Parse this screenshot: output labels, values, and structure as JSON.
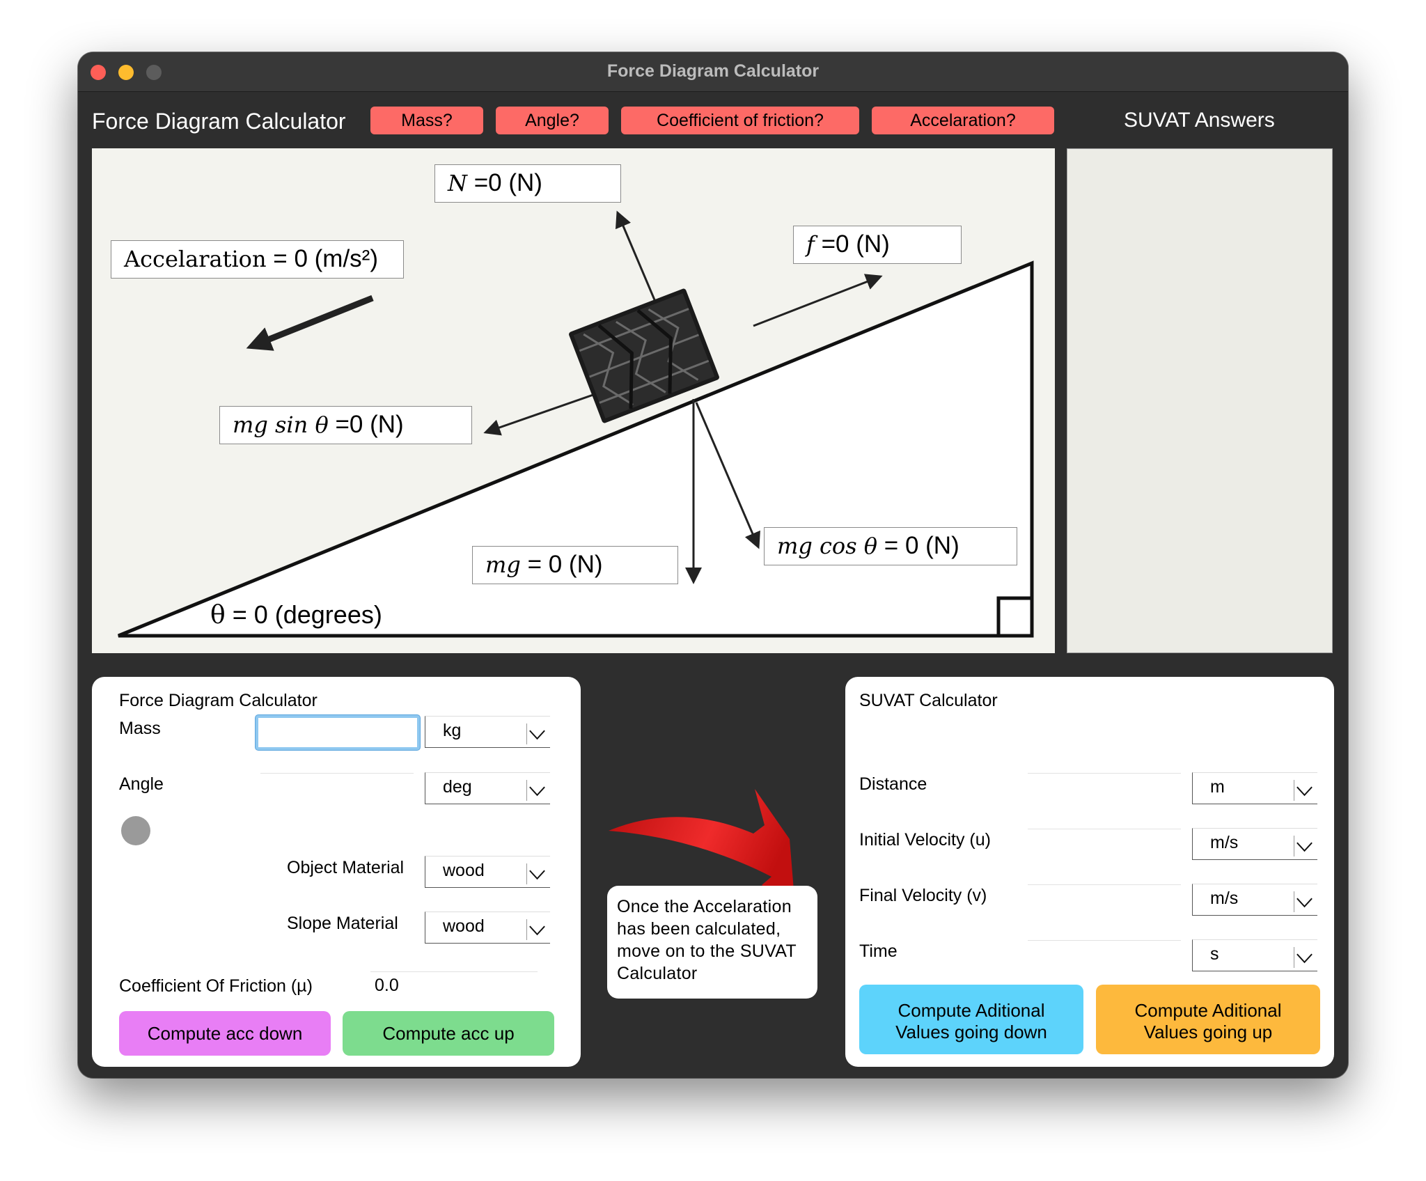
{
  "window": {
    "title": "Force Diagram Calculator"
  },
  "header": {
    "app_title": "Force Diagram Calculator",
    "buttons": [
      "Mass?",
      "Angle?",
      "Coefficient of friction?",
      "Accelaration?"
    ],
    "suvat_answers_title": "SUVAT Answers"
  },
  "diagram": {
    "normal": {
      "symbol": "N",
      "value": "=0 (N)"
    },
    "friction": {
      "symbol": "f",
      "value": "=0 (N)"
    },
    "acceleration": {
      "symbol": "Accelaration",
      "value": "= 0 (m/s²)"
    },
    "mg_sin": {
      "symbol": "mg  sin θ",
      "value": "=0 (N)"
    },
    "mg": {
      "symbol": "mg",
      "value": "= 0 (N)"
    },
    "mg_cos": {
      "symbol": "mg cos θ",
      "value": "= 0 (N)"
    },
    "theta": {
      "symbol": "θ",
      "value": "= 0 (degrees)"
    }
  },
  "force_card": {
    "title": "Force Diagram Calculator",
    "mass_label": "Mass",
    "mass_value": "",
    "mass_unit": "kg",
    "angle_label": "Angle",
    "angle_value": "",
    "angle_unit": "deg",
    "object_material_label": "Object Material",
    "object_material": "wood",
    "slope_material_label": "Slope Material",
    "slope_material": "wood",
    "friction_label": "Coefficient Of Friction (µ)",
    "friction_value": "0.0",
    "compute_down": "Compute acc down",
    "compute_up": "Compute acc up"
  },
  "note": {
    "text": "Once the Accelaration has been calculated, move on to the SUVAT Calculator"
  },
  "suvat_card": {
    "title": "SUVAT Calculator",
    "rows": [
      {
        "label": "Distance",
        "value": "",
        "unit": "m"
      },
      {
        "label": "Initial Velocity (u)",
        "value": "",
        "unit": "m/s"
      },
      {
        "label": "Final Velocity (v)",
        "value": "",
        "unit": "m/s"
      },
      {
        "label": "Time",
        "value": "",
        "unit": "s"
      }
    ],
    "compute_down": "Compute Aditional Values going down",
    "compute_up": "Compute Aditional Values going up"
  },
  "colors": {
    "question_button": "#fd6a66",
    "compute_down": "#e87ef5",
    "compute_up": "#7ddc8e",
    "suvat_down": "#5dd3fb",
    "suvat_up": "#fdb93d",
    "arrow": "#e51b1b"
  },
  "icons": [
    "close-icon",
    "minimize-icon",
    "maximize-icon",
    "chevron-down-icon",
    "tire-icon",
    "red-curved-arrow-icon",
    "right-angle-icon"
  ]
}
